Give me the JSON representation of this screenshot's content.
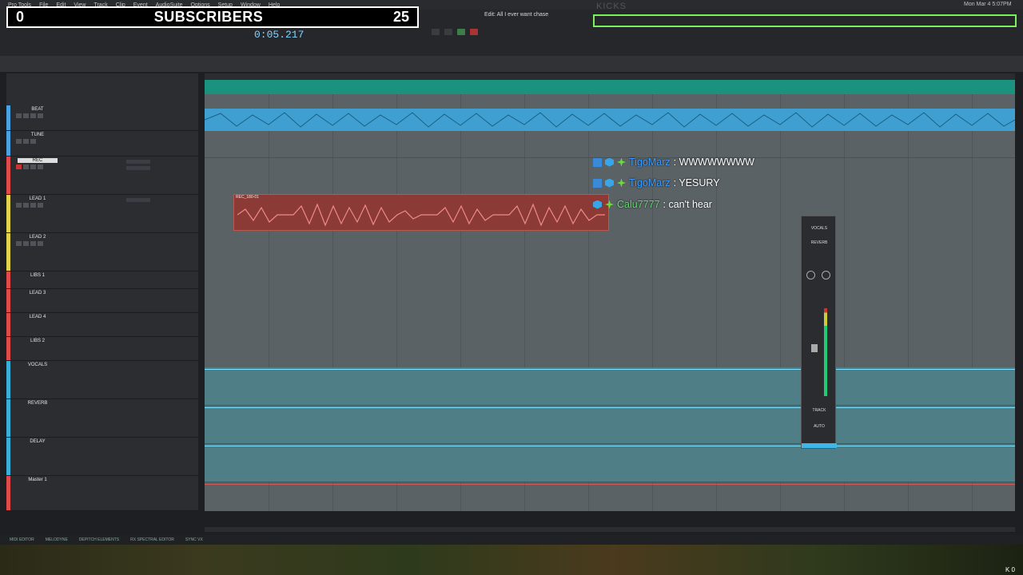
{
  "menubar": {
    "items": [
      "Pro Tools",
      "File",
      "Edit",
      "View",
      "Track",
      "Clip",
      "Event",
      "AudioSuite",
      "Options",
      "Setup",
      "Window",
      "Help"
    ],
    "clock": "Mon Mar 4 5:07PM"
  },
  "overlay": {
    "left_count": "0",
    "title": "SUBSCRIBERS",
    "right_count": "25"
  },
  "transport": {
    "main_counter": "0:05.217",
    "edit_window_title": "Edit: All I ever want chase",
    "kicks": "KICKS"
  },
  "tracks": [
    {
      "name": "BEAT",
      "color": "#4aa3e0"
    },
    {
      "name": "TUNE",
      "color": "#4aa3e0"
    },
    {
      "name": "REC",
      "color": "#e04a4a"
    },
    {
      "name": "LEAD 1",
      "color": "#e0d24a"
    },
    {
      "name": "LEAD 2",
      "color": "#e0d24a"
    },
    {
      "name": "LIBS 1",
      "color": "#e04a4a"
    },
    {
      "name": "LEAD 3",
      "color": "#e04a4a"
    },
    {
      "name": "LEAD 4",
      "color": "#e04a4a"
    },
    {
      "name": "LIBS 2",
      "color": "#e04a4a"
    },
    {
      "name": "VOCALS",
      "color": "#3ab0d8"
    },
    {
      "name": "REVERB",
      "color": "#3ab0d8"
    },
    {
      "name": "DELAY",
      "color": "#3ab0d8"
    },
    {
      "name": "Master 1",
      "color": "#e04a4a"
    }
  ],
  "clips": {
    "rec_clip_label": "REC_180-01"
  },
  "chat": [
    {
      "user": "TigoMarz",
      "message": ": WWWWWWWW",
      "color": "#3b9dff"
    },
    {
      "user": "TigoMarz",
      "message": ": YESURY",
      "color": "#3b9dff"
    },
    {
      "user": "Calu7777",
      "message": ": can't hear",
      "color": "#5ddf6a"
    }
  ],
  "vocal_strip": {
    "name": "VOCALS",
    "send": "REVERB",
    "track_label": "TRACK",
    "auto_label": "AUTO"
  },
  "bottom_tabs": [
    "MIDI EDITOR",
    "MELODYNE",
    "DEPITCH ELEMENTS",
    "RX SPECTRAL EDITOR",
    "SYNC VX"
  ],
  "corner_counter": "K 0"
}
